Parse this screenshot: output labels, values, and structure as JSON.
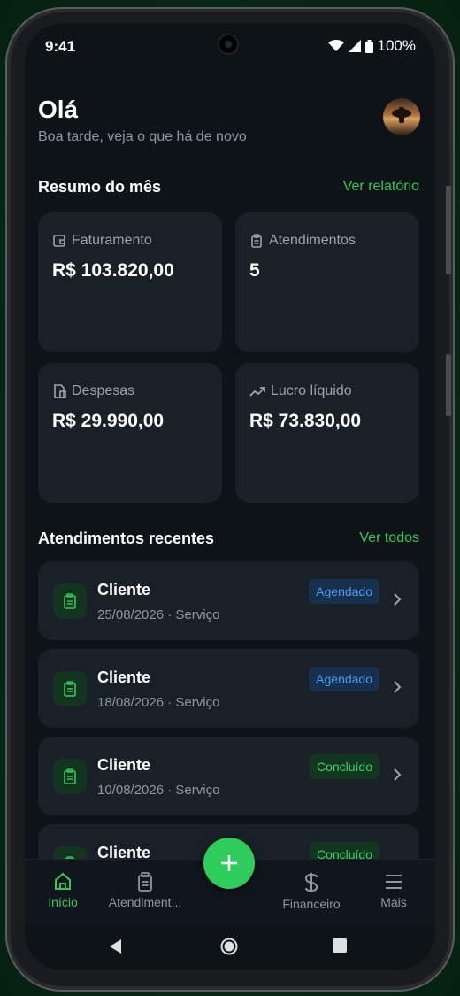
{
  "status": {
    "time": "9:41",
    "battery": "100%"
  },
  "header": {
    "greeting": "Olá",
    "subtitle": "Boa tarde, veja o que há de novo"
  },
  "summary": {
    "title": "Resumo do mês",
    "link": "Ver relatório",
    "cards": [
      {
        "label": "Faturamento",
        "value": "R$ 103.820,00",
        "icon": "wallet-icon"
      },
      {
        "label": "Atendimentos",
        "value": "5",
        "icon": "clipboard-icon"
      },
      {
        "label": "Despesas",
        "value": "R$ 29.990,00",
        "icon": "receipt-icon"
      },
      {
        "label": "Lucro líquido",
        "value": "R$ 73.830,00",
        "icon": "trending-up-icon"
      }
    ]
  },
  "recent": {
    "title": "Atendimentos recentes",
    "link": "Ver todos",
    "items": [
      {
        "name": "Cliente",
        "meta": "25/08/2026 · Serviço",
        "status": "Agendado"
      },
      {
        "name": "Cliente",
        "meta": "18/08/2026 · Serviço",
        "status": "Agendado"
      },
      {
        "name": "Cliente",
        "meta": "10/08/2026 · Serviço",
        "status": "Concluído"
      },
      {
        "name": "Cliente",
        "meta": "",
        "status": "Concluído"
      }
    ]
  },
  "tabs": [
    {
      "label": "Início",
      "icon": "home-icon",
      "active": true
    },
    {
      "label": "Atendiment...",
      "icon": "clipboard-icon"
    },
    {
      "label": "Financeiro",
      "icon": "dollar-icon"
    },
    {
      "label": "Mais",
      "icon": "menu-icon"
    }
  ],
  "colors": {
    "accent": "#34c759",
    "scheduled": "#4a9cf0",
    "done": "#3ad06a",
    "background": "#0e1318",
    "card": "#1a2027"
  }
}
